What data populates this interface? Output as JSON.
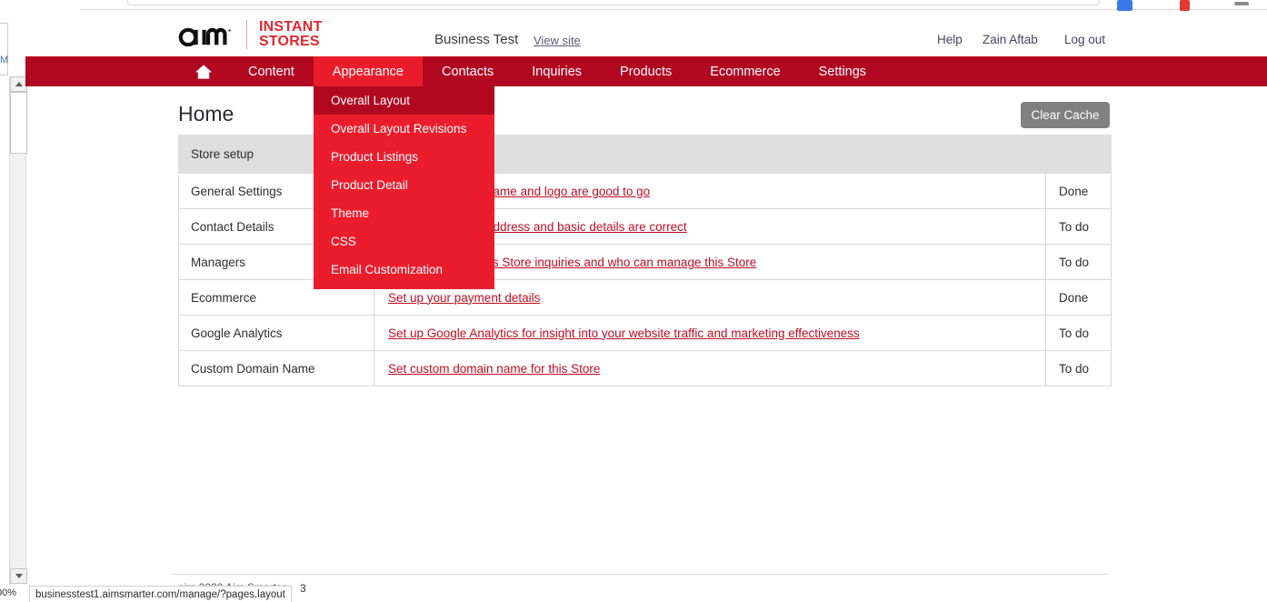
{
  "browser": {
    "zoom_level": "00%",
    "status_url": "businesstest1.aimsmarter.com/manage/?pages.layout"
  },
  "header": {
    "logo_primary": "aim",
    "logo_secondary_line1": "INSTANT",
    "logo_secondary_line2": "STORES",
    "store_name": "Business Test",
    "view_site_label": "View site",
    "help_label": "Help",
    "account_label": "Zain Aftab",
    "logout_label": "Log out"
  },
  "nav": {
    "home_icon": "home-icon",
    "items": [
      {
        "label": "Content",
        "active": false
      },
      {
        "label": "Appearance",
        "active": true
      },
      {
        "label": "Contacts",
        "active": false
      },
      {
        "label": "Inquiries",
        "active": false
      },
      {
        "label": "Products",
        "active": false
      },
      {
        "label": "Ecommerce",
        "active": false
      },
      {
        "label": "Settings",
        "active": false
      }
    ]
  },
  "dropdown": {
    "owner": "Appearance",
    "items": [
      {
        "label": "Overall Layout",
        "hover": true
      },
      {
        "label": "Overall Layout Revisions",
        "hover": false
      },
      {
        "label": "Product Listings",
        "hover": false
      },
      {
        "label": "Product Detail",
        "hover": false
      },
      {
        "label": "Theme",
        "hover": false
      },
      {
        "label": "CSS",
        "hover": false
      },
      {
        "label": "Email Customization",
        "hover": false
      }
    ]
  },
  "page": {
    "title": "Home",
    "clear_cache_label": "Clear Cache"
  },
  "table": {
    "headers": [
      "Store setup",
      "",
      ""
    ],
    "rows": [
      {
        "label": "General Settings",
        "action": "Check your Store name and logo are good to go",
        "status": "Done"
      },
      {
        "label": "Contact Details",
        "action": "Check your Store address and basic details are correct",
        "status": "To do"
      },
      {
        "label": "Managers",
        "action": "Set up who receives Store inquiries and who can manage this Store",
        "status": "To do"
      },
      {
        "label": "Ecommerce",
        "action": "Set up your payment details",
        "status": "Done"
      },
      {
        "label": "Google Analytics",
        "action": "Set up Google Analytics for insight into your website traffic and marketing effectiveness",
        "status": "To do"
      },
      {
        "label": "Custom Domain Name",
        "action": "Set custom domain name for this Store",
        "status": "To do"
      }
    ]
  },
  "footer": {
    "text": "aim 2020 Aim Smarter",
    "page_number": "3"
  },
  "colors": {
    "nav_red": "#b20720",
    "accent_red": "#eb1d2d",
    "link_red": "#c00d22",
    "header_gray": "#dedede",
    "button_gray": "#808080"
  }
}
